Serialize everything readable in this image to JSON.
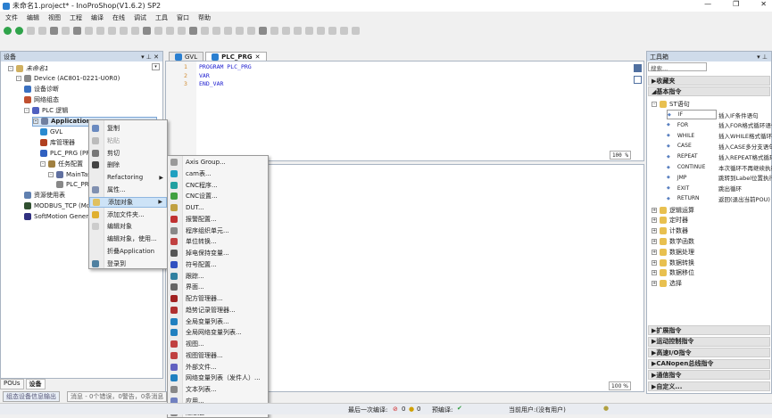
{
  "window": {
    "title": "未命名1.project* - InoProShop(V1.6.2) SP2",
    "minimize": "—",
    "maximize": "❐",
    "close": "✕"
  },
  "menu": [
    "文件",
    "编辑",
    "视图",
    "工程",
    "编译",
    "在线",
    "调试",
    "工具",
    "窗口",
    "帮助"
  ],
  "devices_panel": {
    "title": "设备",
    "tree": [
      {
        "label": "未命名1",
        "indent": 0,
        "exp": "-",
        "color": "#d0b060"
      },
      {
        "label": "Device (AC801-0221-U0R0)",
        "indent": 1,
        "exp": "-",
        "color": "#888"
      },
      {
        "label": "设备诊断",
        "indent": 2,
        "exp": "",
        "color": "#3a70c0"
      },
      {
        "label": "网络组态",
        "indent": 2,
        "exp": "",
        "color": "#c05030"
      },
      {
        "label": "PLC 逻辑",
        "indent": 2,
        "exp": "-",
        "color": "#5060c0"
      },
      {
        "label": "Application",
        "indent": 3,
        "exp": "-",
        "color": "#7080a0",
        "selected": true
      },
      {
        "label": "GVL",
        "indent": 4,
        "exp": "",
        "color": "#2a8ad0"
      },
      {
        "label": "库管理器",
        "indent": 4,
        "exp": "",
        "color": "#b04020"
      },
      {
        "label": "PLC_PRG (PRG)",
        "indent": 4,
        "exp": "",
        "color": "#3060c0"
      },
      {
        "label": "任务配置",
        "indent": 4,
        "exp": "-",
        "color": "#a08040"
      },
      {
        "label": "MainTask",
        "indent": 5,
        "exp": "-",
        "color": "#6070a0"
      },
      {
        "label": "PLC_PRG",
        "indent": 6,
        "exp": "",
        "color": "#888"
      },
      {
        "label": "资源使用表",
        "indent": 2,
        "exp": "",
        "color": "#6080b0"
      },
      {
        "label": "MODBUS_TCP (Modbus TCP)",
        "indent": 2,
        "exp": "",
        "color": "#305030"
      },
      {
        "label": "SoftMotion General Axis Pool",
        "indent": 2,
        "exp": "",
        "color": "#303080"
      }
    ]
  },
  "bottom_tabs": [
    "POUs",
    "设备"
  ],
  "output_tabs": [
    "组态设备信息输出",
    "消息 - 0个错误，0警告，0条消息"
  ],
  "editor": {
    "tabs": [
      {
        "label": "GVL"
      },
      {
        "label": "PLC_PRG",
        "active": true
      }
    ],
    "lines": [
      {
        "n": "1",
        "code": "PROGRAM PLC_PRG"
      },
      {
        "n": "2",
        "code": "VAR"
      },
      {
        "n": "3",
        "code": "END_VAR"
      }
    ],
    "zoom_top": "100 %",
    "zoom_bottom": "100 %"
  },
  "context_menu": [
    {
      "label": "复制",
      "color": "#6a8ac0"
    },
    {
      "label": "粘贴",
      "disabled": true,
      "color": "#bbb"
    },
    {
      "label": "剪切",
      "color": "#777"
    },
    {
      "label": "删除",
      "color": "#444"
    },
    {
      "label": "Refactoring",
      "submenu": true
    },
    {
      "label": "属性...",
      "color": "#8090b0"
    },
    {
      "label": "添加对象",
      "submenu": true,
      "highlighted": true,
      "color": "#e0c060"
    },
    {
      "label": "添加文件夹...",
      "color": "#e0b030"
    },
    {
      "label": "编辑对象",
      "color": "#ccc"
    },
    {
      "label": "编辑对象，使用..."
    },
    {
      "label": "折叠Application"
    },
    {
      "label": "登录到",
      "color": "#5080a0"
    }
  ],
  "submenu": [
    {
      "label": "Axis Group...",
      "color": "#999"
    },
    {
      "label": "cam表...",
      "color": "#20a0c0"
    },
    {
      "label": "CNC程序...",
      "color": "#20a0a0"
    },
    {
      "label": "CNC设置...",
      "color": "#40a040"
    },
    {
      "label": "DUT...",
      "color": "#c0a040"
    },
    {
      "label": "报警配置...",
      "color": "#c03030"
    },
    {
      "label": "程序组织单元...",
      "color": "#888"
    },
    {
      "label": "单位转换...",
      "color": "#c04040"
    },
    {
      "label": "掉电保持变量...",
      "color": "#555"
    },
    {
      "label": "符号配置...",
      "color": "#3050c0"
    },
    {
      "label": "跟踪...",
      "color": "#3080a0"
    },
    {
      "label": "界面...",
      "color": "#666"
    },
    {
      "label": "配方管理器...",
      "color": "#a02020"
    },
    {
      "label": "趋势记录管理器...",
      "color": "#b03030"
    },
    {
      "label": "全局变量列表...",
      "color": "#2080c0"
    },
    {
      "label": "全局网络变量列表...",
      "color": "#2080c0"
    },
    {
      "label": "视图...",
      "color": "#c04040"
    },
    {
      "label": "视图管理器...",
      "color": "#c04040"
    },
    {
      "label": "外部文件...",
      "color": "#6060c0"
    },
    {
      "label": "网络变量列表（发件人）...",
      "color": "#2080c0"
    },
    {
      "label": "文本列表...",
      "color": "#888"
    },
    {
      "label": "应用...",
      "color": "#7080c0"
    },
    {
      "label": "随意边...",
      "color": "#888"
    }
  ],
  "toolbox": {
    "title": "工具箱",
    "search_placeholder": "搜索...",
    "favorites": "收藏夹",
    "basic": "基本指令",
    "st_folder": "ST语句",
    "st_items": [
      {
        "name": "IF",
        "desc": "插入IF条件语句"
      },
      {
        "name": "FOR",
        "desc": "插入FOR格式循环语句"
      },
      {
        "name": "WHILE",
        "desc": "插入WHILE格式循环语句"
      },
      {
        "name": "CASE",
        "desc": "插入CASE多分支语句"
      },
      {
        "name": "REPEAT",
        "desc": "插入REPEAT格式循环语句"
      },
      {
        "name": "CONTINUE",
        "desc": "本次循环不再继续执行"
      },
      {
        "name": "JMP",
        "desc": "跳转到Label位置执行"
      },
      {
        "name": "EXIT",
        "desc": "跳出循环"
      },
      {
        "name": "RETURN",
        "desc": "返回(退出当前POU)"
      }
    ],
    "folders": [
      "逻辑运算",
      "定时器",
      "计数器",
      "数学函数",
      "数据处理",
      "数据转换",
      "数据移位",
      "选择"
    ],
    "sections": [
      "扩展指令",
      "运动控制指令",
      "高速I/O指令",
      "CANopen总线指令",
      "通信指令",
      "自定义..."
    ]
  },
  "status": {
    "last_compile": "最后一次编译:",
    "errors": "0",
    "warnings": "0",
    "precompile": "预编译:",
    "check": "✔",
    "user": "当前用户:(没有用户)"
  }
}
